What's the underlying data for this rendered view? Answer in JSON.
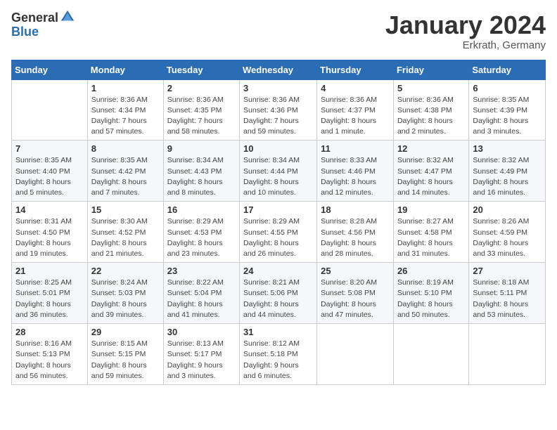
{
  "header": {
    "logo_general": "General",
    "logo_blue": "Blue",
    "title": "January 2024",
    "location": "Erkrath, Germany"
  },
  "calendar": {
    "days_of_week": [
      "Sunday",
      "Monday",
      "Tuesday",
      "Wednesday",
      "Thursday",
      "Friday",
      "Saturday"
    ],
    "weeks": [
      [
        {
          "day": "",
          "info": ""
        },
        {
          "day": "1",
          "info": "Sunrise: 8:36 AM\nSunset: 4:34 PM\nDaylight: 7 hours\nand 57 minutes."
        },
        {
          "day": "2",
          "info": "Sunrise: 8:36 AM\nSunset: 4:35 PM\nDaylight: 7 hours\nand 58 minutes."
        },
        {
          "day": "3",
          "info": "Sunrise: 8:36 AM\nSunset: 4:36 PM\nDaylight: 7 hours\nand 59 minutes."
        },
        {
          "day": "4",
          "info": "Sunrise: 8:36 AM\nSunset: 4:37 PM\nDaylight: 8 hours\nand 1 minute."
        },
        {
          "day": "5",
          "info": "Sunrise: 8:36 AM\nSunset: 4:38 PM\nDaylight: 8 hours\nand 2 minutes."
        },
        {
          "day": "6",
          "info": "Sunrise: 8:35 AM\nSunset: 4:39 PM\nDaylight: 8 hours\nand 3 minutes."
        }
      ],
      [
        {
          "day": "7",
          "info": "Sunrise: 8:35 AM\nSunset: 4:40 PM\nDaylight: 8 hours\nand 5 minutes."
        },
        {
          "day": "8",
          "info": "Sunrise: 8:35 AM\nSunset: 4:42 PM\nDaylight: 8 hours\nand 7 minutes."
        },
        {
          "day": "9",
          "info": "Sunrise: 8:34 AM\nSunset: 4:43 PM\nDaylight: 8 hours\nand 8 minutes."
        },
        {
          "day": "10",
          "info": "Sunrise: 8:34 AM\nSunset: 4:44 PM\nDaylight: 8 hours\nand 10 minutes."
        },
        {
          "day": "11",
          "info": "Sunrise: 8:33 AM\nSunset: 4:46 PM\nDaylight: 8 hours\nand 12 minutes."
        },
        {
          "day": "12",
          "info": "Sunrise: 8:32 AM\nSunset: 4:47 PM\nDaylight: 8 hours\nand 14 minutes."
        },
        {
          "day": "13",
          "info": "Sunrise: 8:32 AM\nSunset: 4:49 PM\nDaylight: 8 hours\nand 16 minutes."
        }
      ],
      [
        {
          "day": "14",
          "info": "Sunrise: 8:31 AM\nSunset: 4:50 PM\nDaylight: 8 hours\nand 19 minutes."
        },
        {
          "day": "15",
          "info": "Sunrise: 8:30 AM\nSunset: 4:52 PM\nDaylight: 8 hours\nand 21 minutes."
        },
        {
          "day": "16",
          "info": "Sunrise: 8:29 AM\nSunset: 4:53 PM\nDaylight: 8 hours\nand 23 minutes."
        },
        {
          "day": "17",
          "info": "Sunrise: 8:29 AM\nSunset: 4:55 PM\nDaylight: 8 hours\nand 26 minutes."
        },
        {
          "day": "18",
          "info": "Sunrise: 8:28 AM\nSunset: 4:56 PM\nDaylight: 8 hours\nand 28 minutes."
        },
        {
          "day": "19",
          "info": "Sunrise: 8:27 AM\nSunset: 4:58 PM\nDaylight: 8 hours\nand 31 minutes."
        },
        {
          "day": "20",
          "info": "Sunrise: 8:26 AM\nSunset: 4:59 PM\nDaylight: 8 hours\nand 33 minutes."
        }
      ],
      [
        {
          "day": "21",
          "info": "Sunrise: 8:25 AM\nSunset: 5:01 PM\nDaylight: 8 hours\nand 36 minutes."
        },
        {
          "day": "22",
          "info": "Sunrise: 8:24 AM\nSunset: 5:03 PM\nDaylight: 8 hours\nand 39 minutes."
        },
        {
          "day": "23",
          "info": "Sunrise: 8:22 AM\nSunset: 5:04 PM\nDaylight: 8 hours\nand 41 minutes."
        },
        {
          "day": "24",
          "info": "Sunrise: 8:21 AM\nSunset: 5:06 PM\nDaylight: 8 hours\nand 44 minutes."
        },
        {
          "day": "25",
          "info": "Sunrise: 8:20 AM\nSunset: 5:08 PM\nDaylight: 8 hours\nand 47 minutes."
        },
        {
          "day": "26",
          "info": "Sunrise: 8:19 AM\nSunset: 5:10 PM\nDaylight: 8 hours\nand 50 minutes."
        },
        {
          "day": "27",
          "info": "Sunrise: 8:18 AM\nSunset: 5:11 PM\nDaylight: 8 hours\nand 53 minutes."
        }
      ],
      [
        {
          "day": "28",
          "info": "Sunrise: 8:16 AM\nSunset: 5:13 PM\nDaylight: 8 hours\nand 56 minutes."
        },
        {
          "day": "29",
          "info": "Sunrise: 8:15 AM\nSunset: 5:15 PM\nDaylight: 8 hours\nand 59 minutes."
        },
        {
          "day": "30",
          "info": "Sunrise: 8:13 AM\nSunset: 5:17 PM\nDaylight: 9 hours\nand 3 minutes."
        },
        {
          "day": "31",
          "info": "Sunrise: 8:12 AM\nSunset: 5:18 PM\nDaylight: 9 hours\nand 6 minutes."
        },
        {
          "day": "",
          "info": ""
        },
        {
          "day": "",
          "info": ""
        },
        {
          "day": "",
          "info": ""
        }
      ]
    ]
  }
}
